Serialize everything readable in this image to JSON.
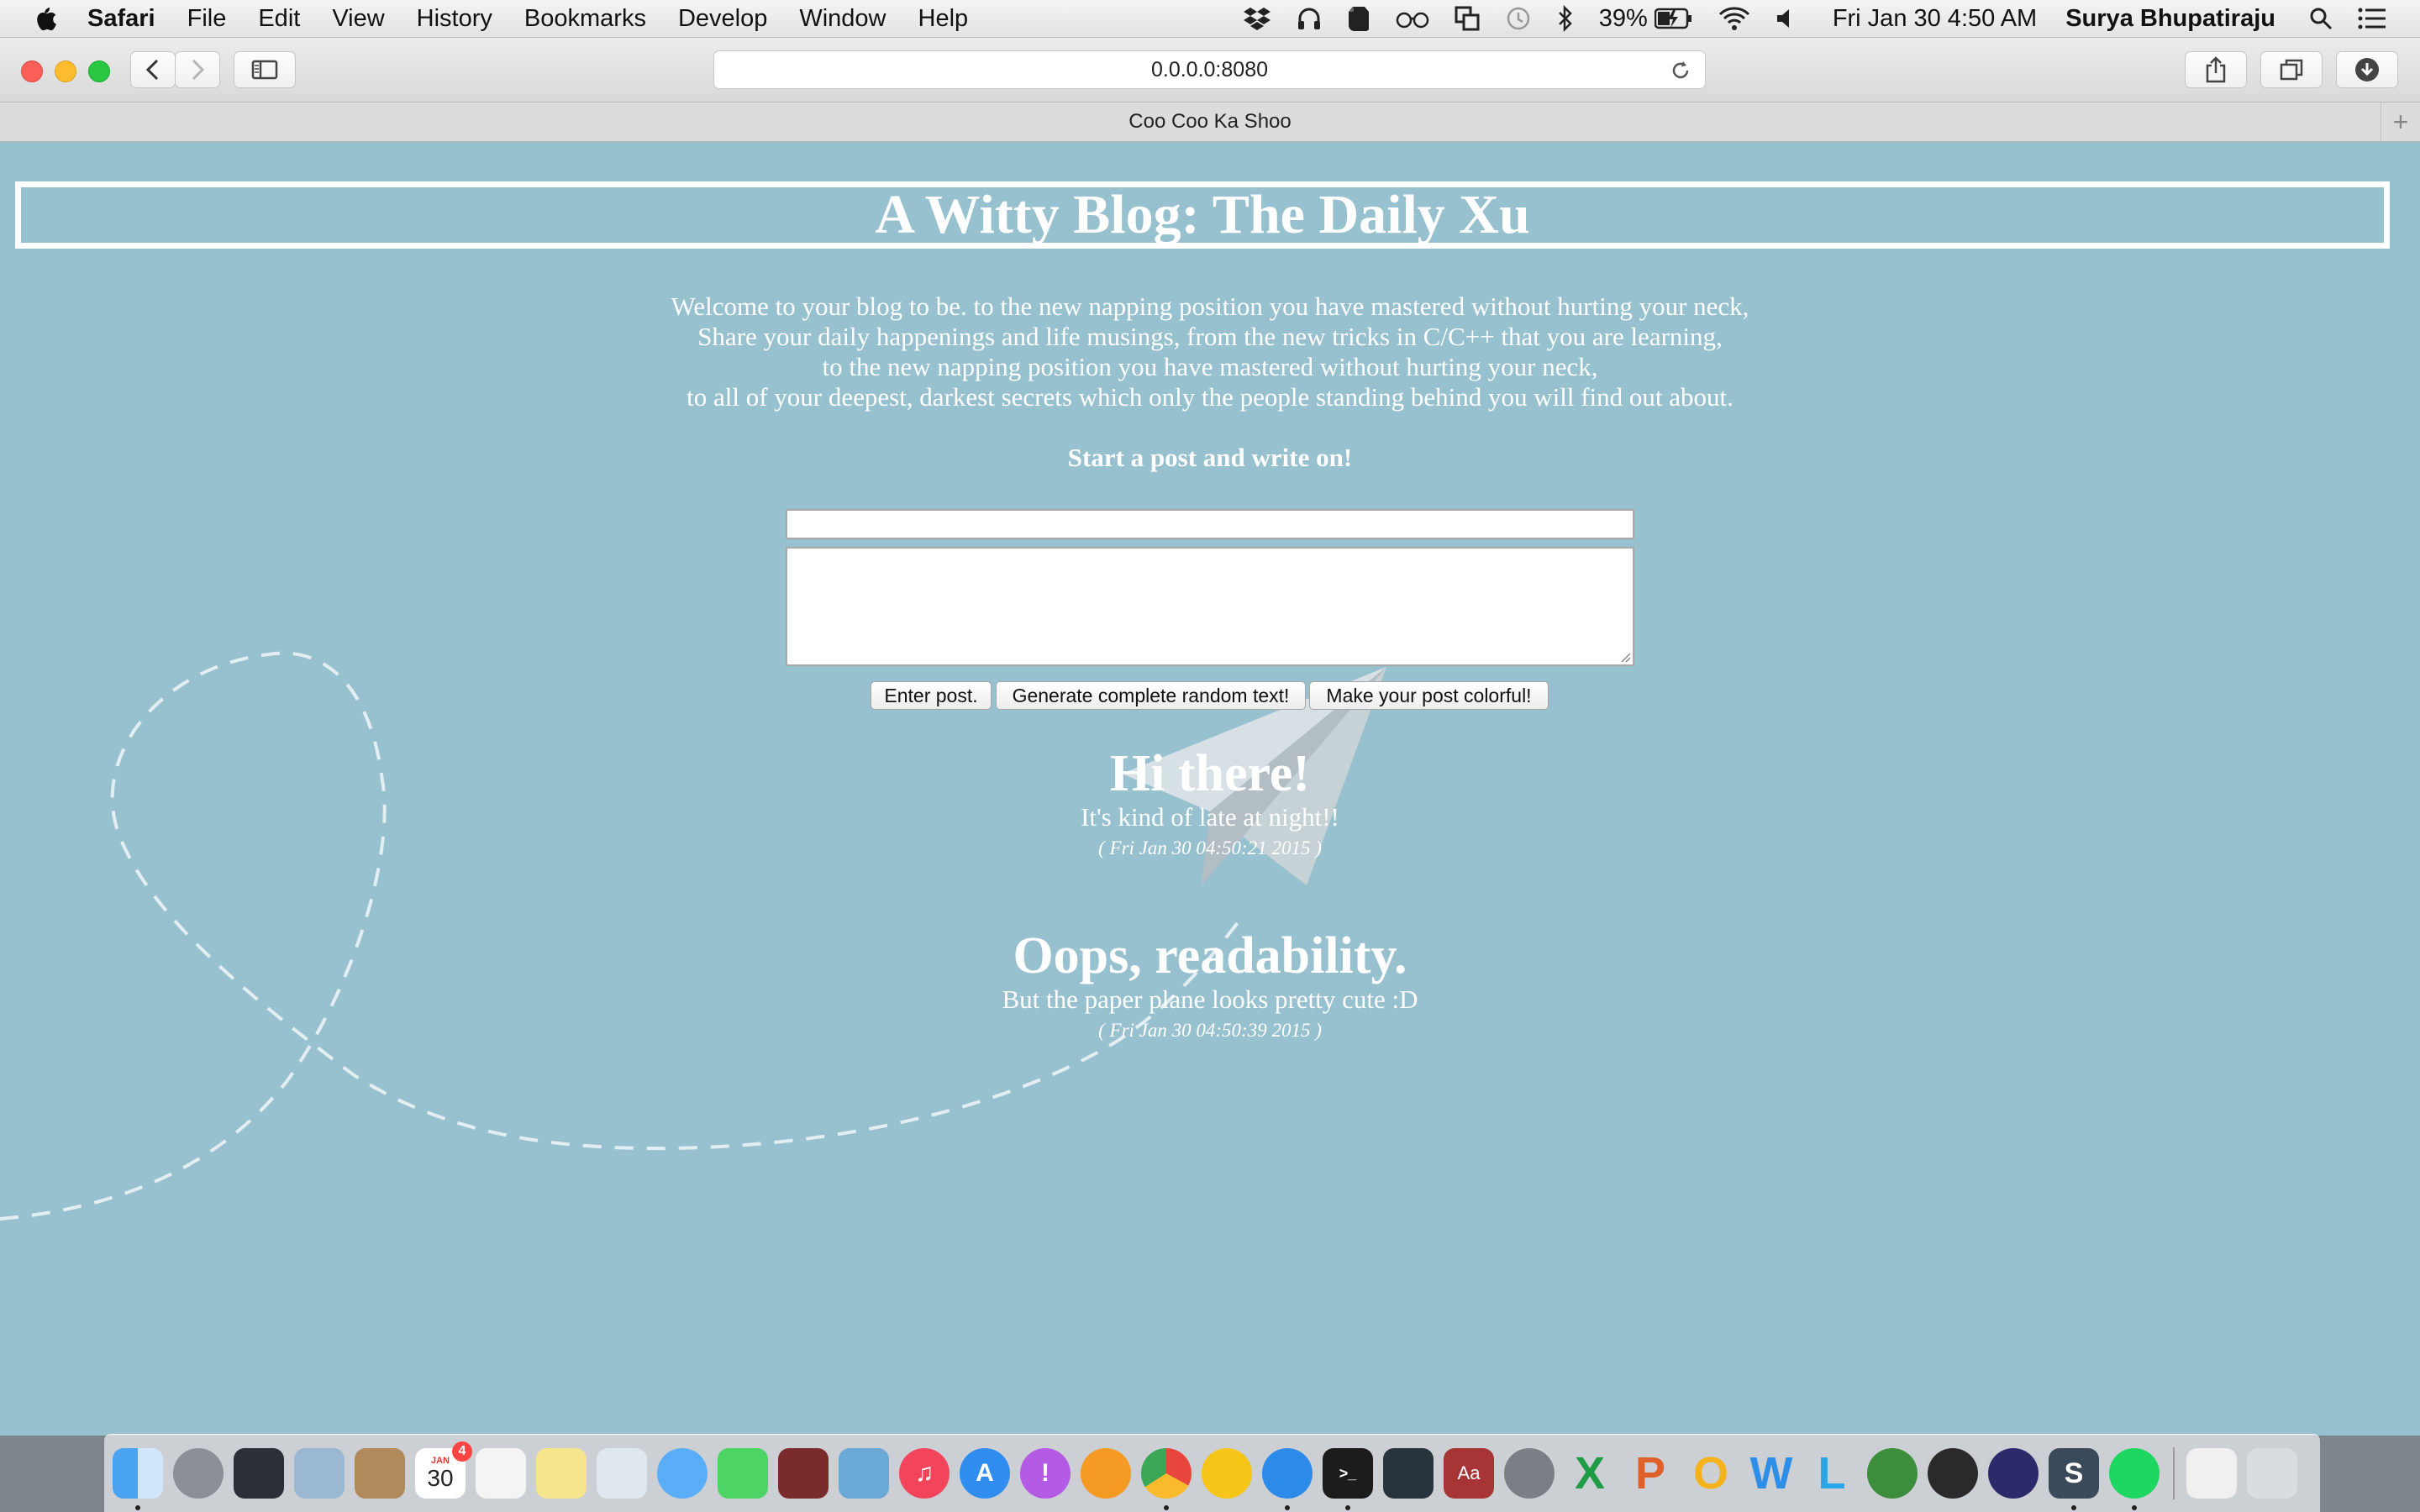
{
  "menubar": {
    "app_name": "Safari",
    "menus": [
      "File",
      "Edit",
      "View",
      "History",
      "Bookmarks",
      "Develop",
      "Window",
      "Help"
    ],
    "battery": "39%",
    "datetime": "Fri Jan 30  4:50 AM",
    "user": "Surya Bhupatiraju",
    "status_icons": [
      "dropbox-icon",
      "headphones-icon",
      "evernote-icon",
      "reading-glasses-icon",
      "copy-icon",
      "time-machine-icon",
      "bluetooth-icon",
      "battery-icon",
      "wifi-icon",
      "volume-icon",
      "spotlight-icon",
      "notification-center-icon"
    ]
  },
  "toolbar": {
    "url": "0.0.0.0:8080"
  },
  "tab": {
    "title": "Coo Coo Ka Shoo",
    "new_tab": "+"
  },
  "blog": {
    "header": "A Witty Blog: The Daily Xu",
    "intro_lines": [
      "Welcome to your blog to be. to the new napping position you have mastered without hurting your neck,",
      "Share your daily happenings and life musings, from the new tricks in C/C++ that you are learning,",
      "to the new napping position you have mastered without hurting your neck,",
      "to all of your deepest, darkest secrets which only the people standing behind you will find out about."
    ],
    "cta": "Start a post and write on!",
    "form": {
      "title_value": "",
      "body_value": "",
      "enter_button": "Enter post.",
      "random_button": "Generate complete random text!",
      "colorful_button": "Make your post colorful!"
    },
    "posts": [
      {
        "title": "Hi there!",
        "body": "It's kind of late at night!!",
        "date": "( Fri Jan 30 04:50:21 2015 )"
      },
      {
        "title": "Oops, readability.",
        "body": "But the paper plane looks pretty cute :D",
        "date": "( Fri Jan 30 04:50:39 2015 )"
      }
    ]
  },
  "colors": {
    "page_background": "#97c1cf",
    "text": "#ffffff"
  },
  "dock": {
    "calendar_month": "JAN",
    "calendar_day": "30",
    "calendar_badge": "4",
    "apps": [
      "finder-icon",
      "launchpad-icon",
      "mission-control-icon",
      "mail-icon",
      "contacts-icon",
      "calendar-icon",
      "reminders-icon",
      "notes-icon",
      "preview-icon",
      "messages-icon",
      "facetime-icon",
      "photo-booth-icon",
      "iphoto-icon",
      "itunes-icon",
      "app-store-icon",
      "podcasts-icon",
      "ibooks-icon",
      "chrome-icon",
      "chrome-canary-icon",
      "safari-icon",
      "terminal-icon",
      "activity-monitor-icon",
      "dictionary-icon",
      "system-preferences-icon",
      "excel-icon",
      "powerpoint-icon",
      "outlook-icon",
      "word-icon",
      "lync-icon",
      "ftp-icon",
      "audio-icon",
      "eclipse-icon",
      "sublime-text-icon",
      "spotify-icon",
      "documents-icon",
      "trash-icon"
    ]
  }
}
